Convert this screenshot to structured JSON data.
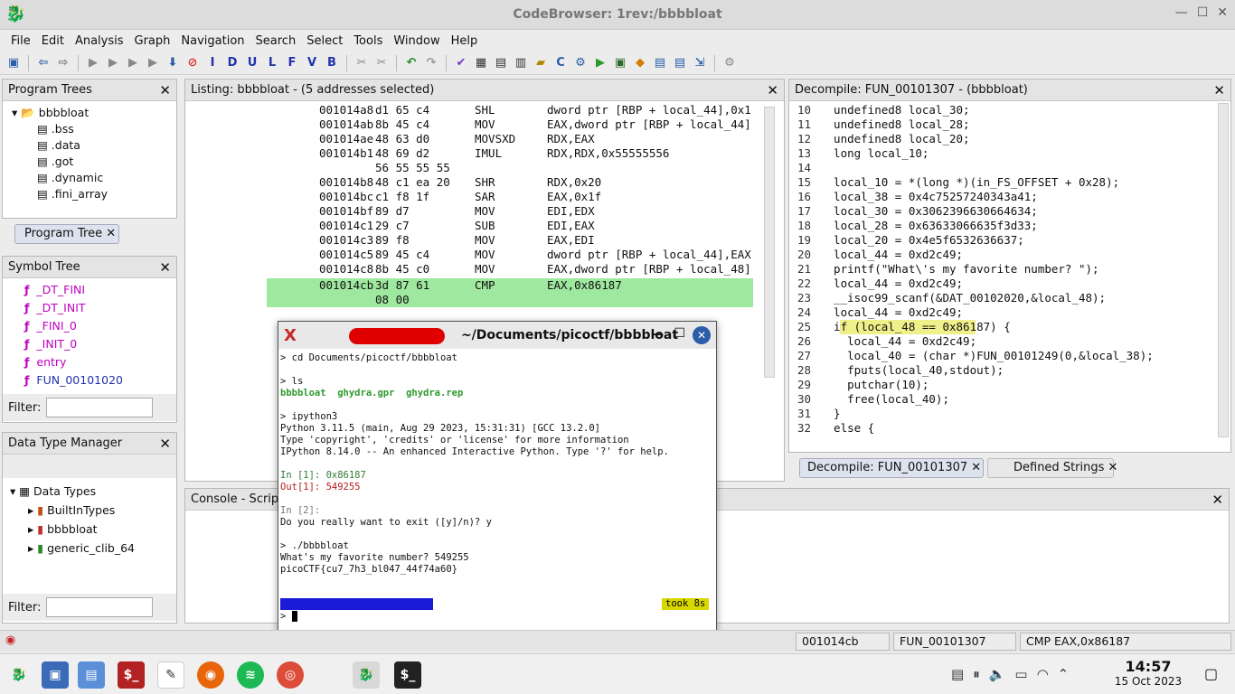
{
  "window_title": "CodeBrowser: 1rev:/bbbbloat",
  "menu": [
    "File",
    "Edit",
    "Analysis",
    "Graph",
    "Navigation",
    "Search",
    "Select",
    "Tools",
    "Window",
    "Help"
  ],
  "program_trees": {
    "title": "Program Trees",
    "root": "bbbbloat",
    "items": [
      ".bss",
      ".data",
      ".got",
      ".dynamic",
      ".fini_array"
    ],
    "tab": "Program Tree"
  },
  "symbol_tree": {
    "title": "Symbol Tree",
    "items": [
      "_DT_FINI",
      "_DT_INIT",
      "_FINI_0",
      "_INIT_0",
      "entry",
      "FUN_00101020"
    ],
    "filter_label": "Filter:"
  },
  "data_type_manager": {
    "title": "Data Type Manager",
    "root": "Data Types",
    "items": [
      "BuiltInTypes",
      "bbbbloat",
      "generic_clib_64"
    ],
    "filter_label": "Filter:"
  },
  "listing": {
    "title": "Listing:  bbbbloat - (5 addresses selected)",
    "rows": [
      {
        "addr": "001014a8",
        "bytes": "d1 65 c4",
        "mn": "SHL",
        "op": "dword ptr [RBP + local_44],0x1"
      },
      {
        "addr": "001014ab",
        "bytes": "8b 45 c4",
        "mn": "MOV",
        "op": "EAX,dword ptr [RBP + local_44]"
      },
      {
        "addr": "001014ae",
        "bytes": "48 63 d0",
        "mn": "MOVSXD",
        "op": "RDX,EAX"
      },
      {
        "addr": "001014b1",
        "bytes": "48 69 d2",
        "mn": "IMUL",
        "op": "RDX,RDX,0x55555556"
      },
      {
        "addr": "",
        "bytes": "56 55 55 55",
        "mn": "",
        "op": ""
      },
      {
        "addr": "001014b8",
        "bytes": "48 c1 ea 20",
        "mn": "SHR",
        "op": "RDX,0x20"
      },
      {
        "addr": "001014bc",
        "bytes": "c1 f8 1f",
        "mn": "SAR",
        "op": "EAX,0x1f"
      },
      {
        "addr": "001014bf",
        "bytes": "89 d7",
        "mn": "MOV",
        "op": "EDI,EDX"
      },
      {
        "addr": "001014c1",
        "bytes": "29 c7",
        "mn": "SUB",
        "op": "EDI,EAX"
      },
      {
        "addr": "001014c3",
        "bytes": "89 f8",
        "mn": "MOV",
        "op": "EAX,EDI"
      },
      {
        "addr": "001014c5",
        "bytes": "89 45 c4",
        "mn": "MOV",
        "op": "dword ptr [RBP + local_44],EAX"
      },
      {
        "addr": "001014c8",
        "bytes": "8b 45 c0",
        "mn": "MOV",
        "op": "EAX,dword ptr [RBP + local_48]"
      },
      {
        "addr": "001014cb",
        "bytes": "3d 87 61",
        "mn": "CMP",
        "op": "EAX,0x86187"
      },
      {
        "addr": "",
        "bytes": "08 00",
        "mn": "",
        "op": ""
      }
    ]
  },
  "decompile": {
    "title": "Decompile: FUN_00101307 -  (bbbbloat)",
    "lines": [
      {
        "n": "10",
        "t": "  undefined8 local_30;"
      },
      {
        "n": "11",
        "t": "  undefined8 local_28;"
      },
      {
        "n": "12",
        "t": "  undefined8 local_20;"
      },
      {
        "n": "13",
        "t": "  long local_10;"
      },
      {
        "n": "14",
        "t": ""
      },
      {
        "n": "15",
        "t": "  local_10 = *(long *)(in_FS_OFFSET + 0x28);"
      },
      {
        "n": "16",
        "t": "  local_38 = 0x4c75257240343a41;"
      },
      {
        "n": "17",
        "t": "  local_30 = 0x3062396630664634;"
      },
      {
        "n": "18",
        "t": "  local_28 = 0x63633066635f3d33;"
      },
      {
        "n": "19",
        "t": "  local_20 = 0x4e5f6532636637;"
      },
      {
        "n": "20",
        "t": "  local_44 = 0xd2c49;"
      },
      {
        "n": "21",
        "t": "  printf(\"What\\'s my favorite number? \");"
      },
      {
        "n": "22",
        "t": "  local_44 = 0xd2c49;"
      },
      {
        "n": "23",
        "t": "  __isoc99_scanf(&DAT_00102020,&local_48);"
      },
      {
        "n": "24",
        "t": "  local_44 = 0xd2c49;"
      },
      {
        "n": "25",
        "t": "  if (local_48 == 0x86187) {"
      },
      {
        "n": "26",
        "t": "    local_44 = 0xd2c49;"
      },
      {
        "n": "27",
        "t": "    local_40 = (char *)FUN_00101249(0,&local_38);"
      },
      {
        "n": "28",
        "t": "    fputs(local_40,stdout);"
      },
      {
        "n": "29",
        "t": "    putchar(10);"
      },
      {
        "n": "30",
        "t": "    free(local_40);"
      },
      {
        "n": "31",
        "t": "  }"
      },
      {
        "n": "32",
        "t": "  else {"
      }
    ],
    "tabs": [
      "Decompile: FUN_00101307",
      "Defined Strings"
    ]
  },
  "console": {
    "title": "Console - Scrip"
  },
  "terminal": {
    "title": "~/Documents/picoctf/bbbbloat",
    "lines": [
      {
        "cls": "",
        "t": "> cd Documents/picoctf/bbbbloat"
      },
      {
        "cls": "",
        "t": ""
      },
      {
        "cls": "",
        "t": "> ls"
      },
      {
        "cls": "",
        "t": "bbbbloat  ghydra.gpr  ghydra.rep"
      },
      {
        "cls": "",
        "t": ""
      },
      {
        "cls": "",
        "t": "> ipython3"
      },
      {
        "cls": "",
        "t": "Python 3.11.5 (main, Aug 29 2023, 15:31:31) [GCC 13.2.0]"
      },
      {
        "cls": "",
        "t": "Type 'copyright', 'credits' or 'license' for more information"
      },
      {
        "cls": "",
        "t": "IPython 8.14.0 -- An enhanced Interactive Python. Type '?' for help."
      },
      {
        "cls": "",
        "t": ""
      },
      {
        "cls": "",
        "t": "In [1]: 0x86187"
      },
      {
        "cls": "",
        "t": "Out[1]: 549255"
      },
      {
        "cls": "",
        "t": ""
      },
      {
        "cls": "",
        "t": "In [2]:"
      },
      {
        "cls": "",
        "t": "Do you really want to exit ([y]/n)? y"
      },
      {
        "cls": "",
        "t": ""
      },
      {
        "cls": "",
        "t": "> ./bbbbloat"
      },
      {
        "cls": "",
        "t": "What's my favorite number? 549255"
      },
      {
        "cls": "",
        "t": "picoCTF{cu7_7h3_bl047_44f74a60}"
      }
    ],
    "prompt_path": "~/Documents/picoctf/bbbbloat",
    "took": "took 8s"
  },
  "status": {
    "addr": "001014cb",
    "func": "FUN_00101307",
    "instr": "CMP EAX,0x86187"
  },
  "clock": {
    "time": "14:57",
    "date": "15 Oct 2023"
  }
}
